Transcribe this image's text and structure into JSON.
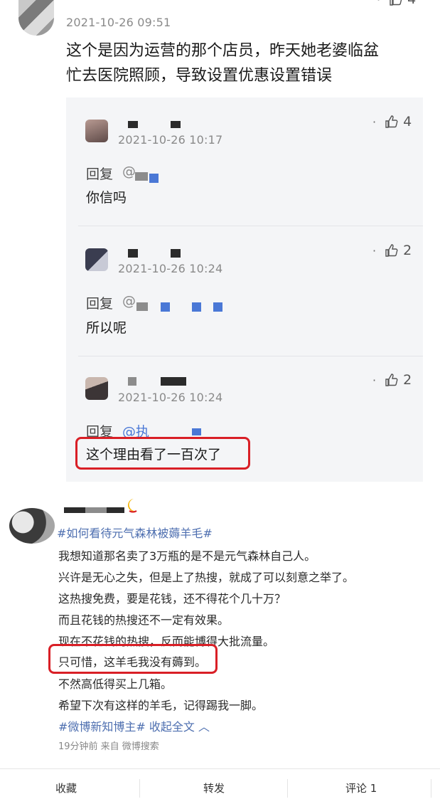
{
  "top_comment": {
    "timestamp": "2021-10-26 09:51",
    "text_line1": "这个是因为运营的那个店员，昨天她老婆临盆",
    "text_line2": "忙去医院照顾，导致设置优惠设置错误",
    "like_count": "4"
  },
  "replies": [
    {
      "timestamp": "2021-10-26 10:17",
      "reply_label": "回复",
      "at": "@",
      "text": "你信吗",
      "like_count": "4"
    },
    {
      "timestamp": "2021-10-26 10:24",
      "reply_label": "回复",
      "at": "@",
      "text": "所以呢",
      "like_count": "2"
    },
    {
      "timestamp": "2021-10-26 10:24",
      "reply_label": "回复",
      "at": "@执",
      "text": "这个理由看了一百次了",
      "like_count": "2"
    }
  ],
  "post": {
    "hashtag_title": "#如何看待元气森林被薅羊毛#",
    "lines": [
      "我想知道那名卖了3万瓶的是不是元气森林自己人。",
      "兴许是无心之失，但是上了热搜，就成了可以刻意之举了。",
      "这热搜免费，要是花钱，还不得花个几十万？",
      "而且花钱的热搜还不一定有效果。",
      "现在不花钱的热搜，反而能博得大批流量。",
      "只可惜，这羊毛我没有薅到。",
      "不然高低得买上几箱。",
      "希望下次有这样的羊毛，记得踢我一脚。"
    ],
    "footer_tag": "#微博新知博主#",
    "collapse_label": "收起全文",
    "meta": "19分钟前  来自 微博搜索"
  },
  "bottom_bar": {
    "favorite": "收藏",
    "repost": "转发",
    "comment": "评论 1"
  },
  "colors": {
    "highlight_border": "#d91f26",
    "hashtag": "#4e6fb0",
    "reply_bg": "#f4f5f7"
  }
}
